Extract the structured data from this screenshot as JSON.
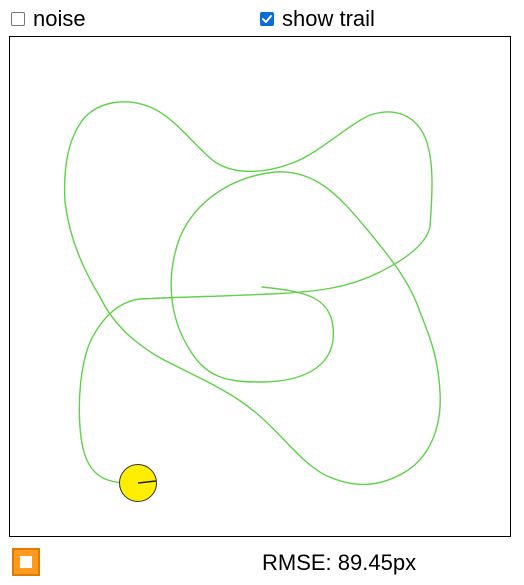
{
  "controls": {
    "noise": {
      "label": "noise",
      "checked": false
    },
    "show_trail": {
      "label": "show trail",
      "checked": true
    }
  },
  "status": {
    "rmse_prefix": "RMSE: ",
    "rmse_value": "89.45px"
  },
  "colors": {
    "trail": "#5fd14a",
    "robot_fill": "#ffee00",
    "robot_outline": "#333333",
    "stop_button": "#ff9a1f"
  },
  "icons": {
    "stop_button": "stop-square-icon"
  }
}
